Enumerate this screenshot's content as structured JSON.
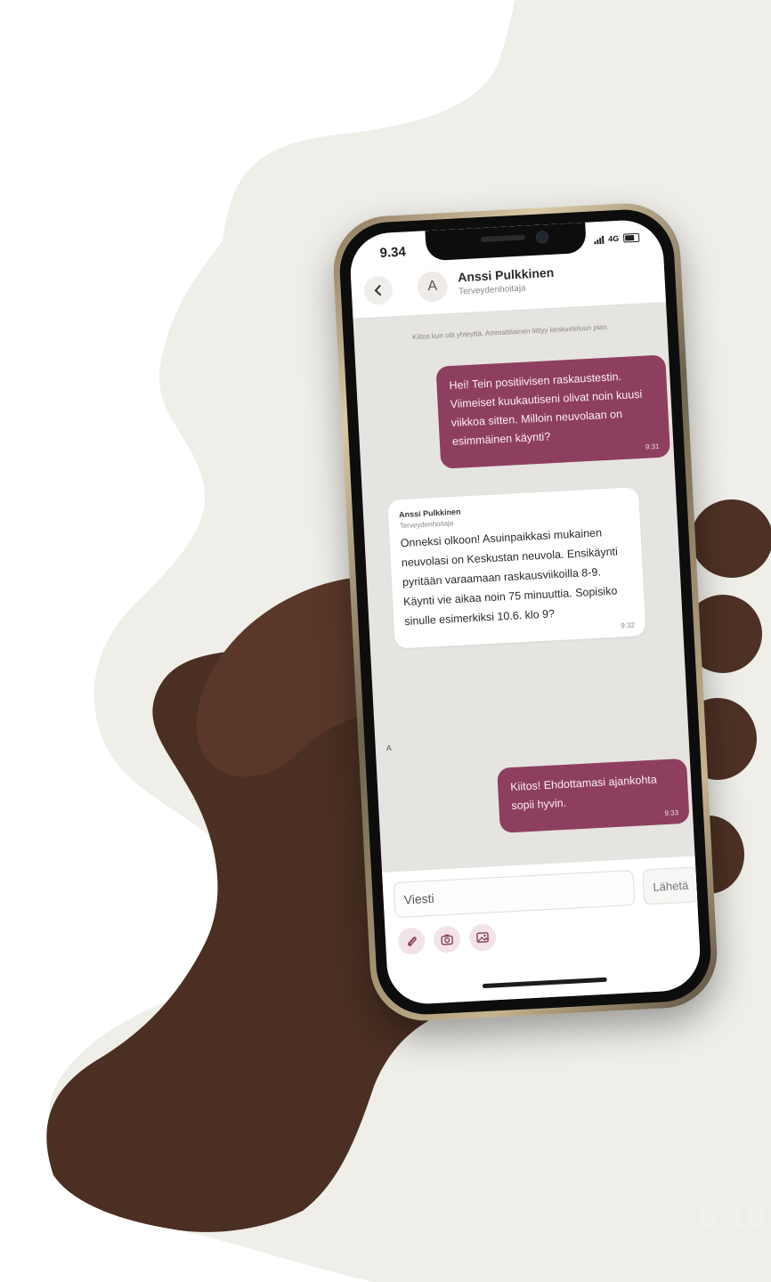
{
  "status_bar": {
    "time": "9.34",
    "network": "4G"
  },
  "header": {
    "back_icon": "chevron-left-icon",
    "avatar_initial": "A",
    "contact_name": "Anssi Pulkkinen",
    "contact_role": "Terveydenhoitaja"
  },
  "chat": {
    "system_note": "Kiitos kun otit yhteyttä. Ammattilainen liittyy keskusteluun pian.",
    "messages": [
      {
        "direction": "outgoing",
        "text": "Hei! Tein positiivisen raskaustestin. Viimeiset kuukautiseni olivat noin kuusi viikkoa sitten. Milloin neuvolaan on esimmäinen käynti?",
        "time": "9:31"
      },
      {
        "direction": "incoming",
        "sender": "Anssi Pulkkinen",
        "sender_role": "Terveydenhoitaja",
        "text": "Onneksi olkoon! Asuinpaikkasi mukainen neuvolasi on Keskustan neuvola. Ensikäynti pyritään varaamaan raskausviikoilla 8-9. Käynti vie aikaa noin 75 minuuttia. Sopisiko sinulle esimerkiksi 10.6. klo 9?",
        "time": "9:32",
        "avatar_initial": "A"
      },
      {
        "direction": "outgoing",
        "text": "Kiitos! Ehdottamasi ajankohta sopii hyvin.",
        "time": "9:33"
      }
    ]
  },
  "composer": {
    "placeholder": "Viesti",
    "send_label": "Lähetä",
    "attachments": [
      "paperclip-icon",
      "camera-icon",
      "image-icon"
    ]
  },
  "date_label": "6.10.",
  "colors": {
    "accent": "#8e3f60",
    "background_shape": "#efeee9",
    "chat_background": "#e6e4e0"
  }
}
